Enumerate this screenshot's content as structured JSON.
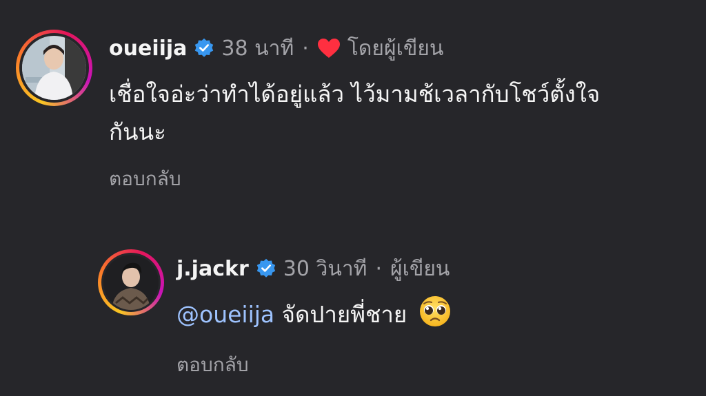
{
  "comments": [
    {
      "username": "oueiija",
      "time": "38 นาที",
      "separator": "·",
      "author_tag": "โดยผู้เขียน",
      "text_line1": "เชื่อใจอ่ะว่าทำได้อยู่แล้ว ไว้มามช้เวลากับโชว์ตั้งใจ",
      "text_line2": "กันนะ",
      "reply_label": "ตอบกลับ"
    },
    {
      "username": "j.jackr",
      "time": "30 วินาที",
      "separator": "·",
      "author_tag": "ผู้เขียน",
      "mention": "@oueiija",
      "text": "จัดปายพี่ชาย",
      "emoji": "pleading-face-emoji",
      "reply_label": "ตอบกลับ"
    }
  ],
  "icons": {
    "verified": "verified-badge-icon",
    "heart": "heart-icon"
  },
  "colors": {
    "background": "#26262a",
    "verified": "#3897f0",
    "heart": "#ff2f40",
    "mention": "#9ec3ff",
    "muted": "#a3a3a8"
  }
}
